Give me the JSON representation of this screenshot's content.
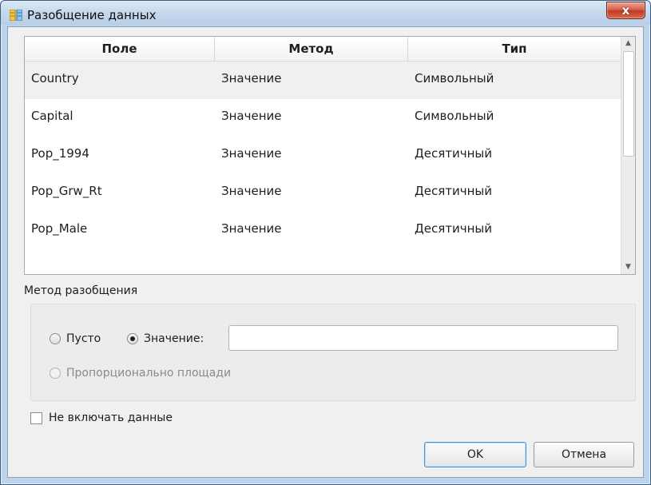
{
  "window": {
    "title": "Разобщение данных",
    "app_icon": "split-data-icon",
    "close_label": "x"
  },
  "table": {
    "columns": [
      "Поле",
      "Метод",
      "Тип"
    ],
    "rows": [
      [
        "Country",
        "Значение",
        "Символьный"
      ],
      [
        "Capital",
        "Значение",
        "Символьный"
      ],
      [
        "Pop_1994",
        "Значение",
        "Десятичный"
      ],
      [
        "Pop_Grw_Rt",
        "Значение",
        "Десятичный"
      ],
      [
        "Pop_Male",
        "Значение",
        "Десятичный"
      ]
    ],
    "selected_row": 0
  },
  "method": {
    "group_label": "Метод разобщения",
    "empty_label": "Пусто",
    "value_label": "Значение:",
    "value_input": "",
    "proportional_label": "Пропорционально площади",
    "selected": "value"
  },
  "options": {
    "exclude_data_label": "Не включать данные",
    "exclude_data_checked": false
  },
  "buttons": {
    "ok_label": "OK",
    "cancel_label": "Отмена"
  },
  "colors": {
    "accent": "#4a90d9",
    "close_button": "#c0391f"
  }
}
